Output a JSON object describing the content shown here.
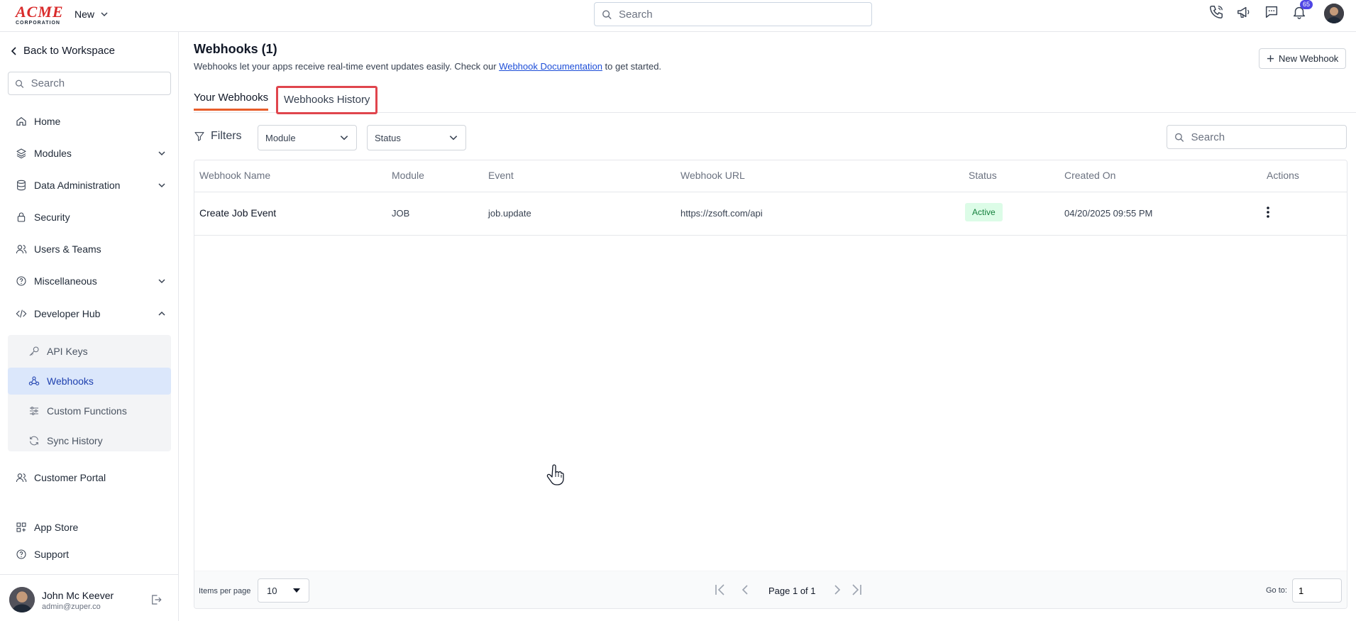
{
  "topbar": {
    "logo_main": "ACME",
    "logo_sub": "CORPORATION",
    "new_label": "New",
    "search_placeholder": "Search",
    "notification_count": "65",
    "icons": [
      "phone-icon",
      "megaphone-icon",
      "chat-icon",
      "bell-icon"
    ]
  },
  "sidebar": {
    "back_label": "Back to Workspace",
    "search_placeholder": "Search",
    "items": [
      {
        "label": "Home",
        "icon": "home-icon"
      },
      {
        "label": "Modules",
        "icon": "layers-icon"
      },
      {
        "label": "Data Administration",
        "icon": "database-icon"
      },
      {
        "label": "Security",
        "icon": "lock-icon"
      },
      {
        "label": "Users & Teams",
        "icon": "users-icon"
      },
      {
        "label": "Miscellaneous",
        "icon": "help-circle-icon"
      },
      {
        "label": "Developer Hub",
        "icon": "code-icon"
      }
    ],
    "dev_hub_items": [
      {
        "label": "API Keys",
        "icon": "key-icon"
      },
      {
        "label": "Webhooks",
        "icon": "webhook-icon"
      },
      {
        "label": "Custom Functions",
        "icon": "sliders-icon"
      },
      {
        "label": "Sync History",
        "icon": "refresh-icon"
      }
    ],
    "bottom_items": [
      {
        "label": "Customer Portal",
        "icon": "users-icon"
      },
      {
        "label": "App Store",
        "icon": "grid-icon"
      },
      {
        "label": "Support",
        "icon": "help-circle-icon"
      }
    ],
    "user": {
      "name": "John Mc Keever",
      "email": "admin@zuper.co"
    }
  },
  "main": {
    "title": "Webhooks (1)",
    "description_before": "Webhooks let your apps receive real-time event updates easily. Check our ",
    "description_link": "Webhook Documentation",
    "description_after": " to get started.",
    "new_button": "New Webhook",
    "tabs": [
      {
        "label": "Your Webhooks",
        "active": true
      },
      {
        "label": "Webhooks History",
        "active": false
      }
    ],
    "filters_label": "Filters",
    "module_select": "Module",
    "status_select": "Status",
    "table_search_placeholder": "Search",
    "columns": [
      "Webhook Name",
      "Module",
      "Event",
      "Webhook URL",
      "Status",
      "Created On",
      "Actions"
    ],
    "rows": [
      {
        "name": "Create Job Event",
        "module": "JOB",
        "event": "job.update",
        "url": "https://zsoft.com/api",
        "status": "Active",
        "created_on": "04/20/2025 09:55 PM"
      }
    ],
    "pager": {
      "items_per_page_label": "Items per page",
      "items_per_page": "10",
      "page_info": "Page 1 of 1",
      "goto_label": "Go to:",
      "goto_value": "1"
    }
  },
  "colors": {
    "accent": "#e85d2a",
    "highlight_box": "#e0454d",
    "active_nav_bg": "#dbe7fb",
    "status_active_bg": "#dcfce7",
    "status_active_fg": "#15803d",
    "badge": "#4f46e5"
  }
}
